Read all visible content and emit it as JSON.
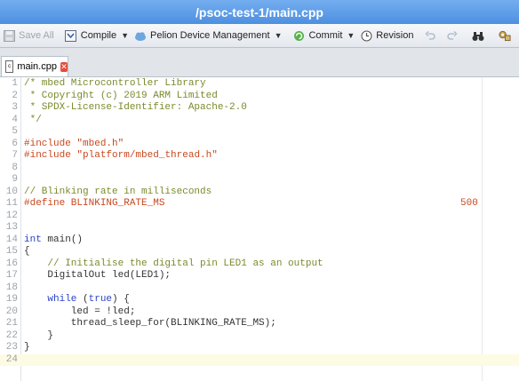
{
  "window": {
    "title": "/psoc-test-1/main.cpp"
  },
  "toolbar": {
    "save_all": "Save All",
    "compile": "Compile",
    "pelion": "Pelion Device Management",
    "commit": "Commit",
    "revision": "Revision"
  },
  "tab": {
    "label": "main.cpp"
  },
  "editor": {
    "current_line": 24,
    "lines": [
      {
        "num": "1",
        "segments": [
          {
            "text": "/* mbed Microcontroller Library",
            "kind": "cm"
          }
        ]
      },
      {
        "num": "2",
        "segments": [
          {
            "text": " * Copyright (c) 2019 ARM Limited",
            "kind": "cm"
          }
        ]
      },
      {
        "num": "3",
        "segments": [
          {
            "text": " * SPDX-License-Identifier: Apache-2.0",
            "kind": "cm"
          }
        ]
      },
      {
        "num": "4",
        "segments": [
          {
            "text": " */",
            "kind": "cm"
          }
        ]
      },
      {
        "num": "5",
        "segments": []
      },
      {
        "num": "6",
        "segments": [
          {
            "text": "#include ",
            "kind": "pp"
          },
          {
            "text": "\"mbed.h\"",
            "kind": "str"
          }
        ]
      },
      {
        "num": "7",
        "segments": [
          {
            "text": "#include ",
            "kind": "pp"
          },
          {
            "text": "\"platform/mbed_thread.h\"",
            "kind": "str"
          }
        ]
      },
      {
        "num": "8",
        "segments": []
      },
      {
        "num": "9",
        "segments": []
      },
      {
        "num": "10",
        "segments": [
          {
            "text": "// Blinking rate in milliseconds",
            "kind": "cm"
          }
        ]
      },
      {
        "num": "11",
        "segments": [
          {
            "text": "#define BLINKING_RATE_MS",
            "kind": "pp"
          }
        ],
        "value": "500"
      },
      {
        "num": "12",
        "segments": []
      },
      {
        "num": "13",
        "segments": []
      },
      {
        "num": "14",
        "segments": [
          {
            "text": "int",
            "kind": "kw"
          },
          {
            "text": " main()",
            "kind": "tx"
          }
        ]
      },
      {
        "num": "15",
        "segments": [
          {
            "text": "{",
            "kind": "tx"
          }
        ]
      },
      {
        "num": "16",
        "segments": [
          {
            "text": "    // Initialise the digital pin LED1 as an output",
            "kind": "cm"
          }
        ]
      },
      {
        "num": "17",
        "segments": [
          {
            "text": "    DigitalOut led(LED1);",
            "kind": "tx"
          }
        ]
      },
      {
        "num": "18",
        "segments": []
      },
      {
        "num": "19",
        "segments": [
          {
            "text": "    ",
            "kind": "tx"
          },
          {
            "text": "while",
            "kind": "kw"
          },
          {
            "text": " (",
            "kind": "tx"
          },
          {
            "text": "true",
            "kind": "kw"
          },
          {
            "text": ") {",
            "kind": "tx"
          }
        ]
      },
      {
        "num": "20",
        "segments": [
          {
            "text": "        led = !led;",
            "kind": "tx"
          }
        ]
      },
      {
        "num": "21",
        "segments": [
          {
            "text": "        thread_sleep_for(BLINKING_RATE_MS);",
            "kind": "tx"
          }
        ]
      },
      {
        "num": "22",
        "segments": [
          {
            "text": "    }",
            "kind": "tx"
          }
        ]
      },
      {
        "num": "23",
        "segments": [
          {
            "text": "}",
            "kind": "tx"
          }
        ]
      },
      {
        "num": "24",
        "segments": []
      }
    ]
  }
}
